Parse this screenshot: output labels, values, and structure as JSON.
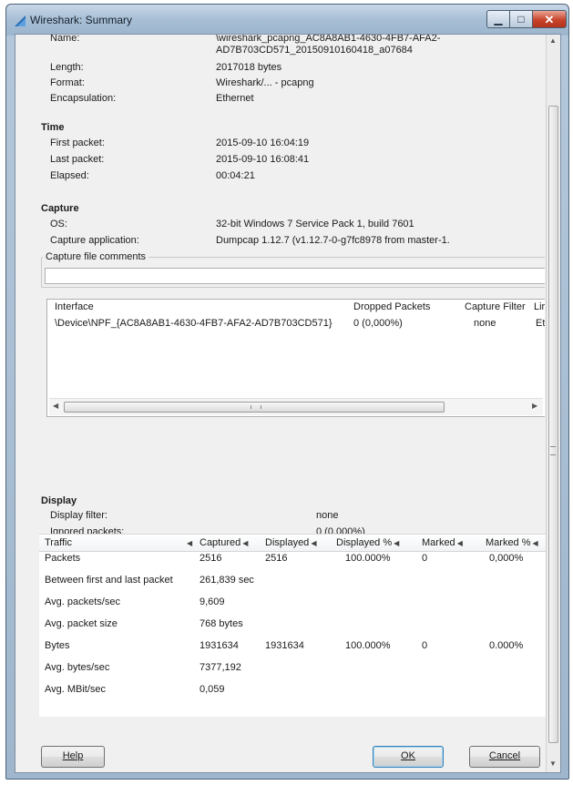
{
  "window": {
    "title": "Wireshark: Summary"
  },
  "file": {
    "name_label": "Name:",
    "name_value_line1": "\\wireshark_pcapng_AC8A8AB1-4630-4FB7-AFA2-",
    "name_value_line2": "AD7B703CD571_20150910160418_a07684",
    "length_label": "Length:",
    "length_value": "2017018 bytes",
    "format_label": "Format:",
    "format_value": "Wireshark/... - pcapng",
    "encap_label": "Encapsulation:",
    "encap_value": "Ethernet"
  },
  "time": {
    "heading": "Time",
    "first_label": "First packet:",
    "first_value": "2015-09-10 16:04:19",
    "last_label": "Last packet:",
    "last_value": "2015-09-10 16:08:41",
    "elapsed_label": "Elapsed:",
    "elapsed_value": "00:04:21"
  },
  "capture": {
    "heading": "Capture",
    "os_label": "OS:",
    "os_value": "32-bit Windows 7 Service Pack 1, build 7601",
    "app_label": "Capture application:",
    "app_value": "Dumpcap 1.12.7 (v1.12.7-0-g7fc8978 from master-1.",
    "comments_label": "Capture file comments",
    "comments_value": ""
  },
  "interfaces": {
    "headers": {
      "interface": "Interface",
      "dropped": "Dropped Packets",
      "filter": "Capture Filter",
      "link": "Lir"
    },
    "rows": [
      {
        "interface": "\\Device\\NPF_{AC8A8AB1-4630-4FB7-AFA2-AD7B703CD571}",
        "dropped": "0 (0,000%)",
        "filter": "none",
        "link": "Et"
      }
    ]
  },
  "display": {
    "heading": "Display",
    "filter_label": "Display filter:",
    "filter_value": "none",
    "ignored_label": "Ignored packets:",
    "ignored_value": "0 (0,000%)"
  },
  "traffic": {
    "headers": [
      "Traffic",
      "Captured",
      "Displayed",
      "Displayed %",
      "Marked",
      "Marked %"
    ],
    "rows": [
      [
        "Packets",
        "2516",
        "2516",
        "100.000%",
        "0",
        "0,000%"
      ],
      [
        "Between first and last packet",
        "261,839 sec",
        "",
        "",
        "",
        ""
      ],
      [
        "Avg. packets/sec",
        "9,609",
        "",
        "",
        "",
        ""
      ],
      [
        "Avg. packet size",
        "768 bytes",
        "",
        "",
        "",
        ""
      ],
      [
        "Bytes",
        "1931634",
        "1931634",
        "100.000%",
        "0",
        "0.000%"
      ],
      [
        "Avg. bytes/sec",
        "7377,192",
        "",
        "",
        "",
        ""
      ],
      [
        "Avg. MBit/sec",
        "0,059",
        "",
        "",
        "",
        ""
      ]
    ]
  },
  "buttons": {
    "help": "Help",
    "ok": "OK",
    "cancel": "Cancel"
  }
}
